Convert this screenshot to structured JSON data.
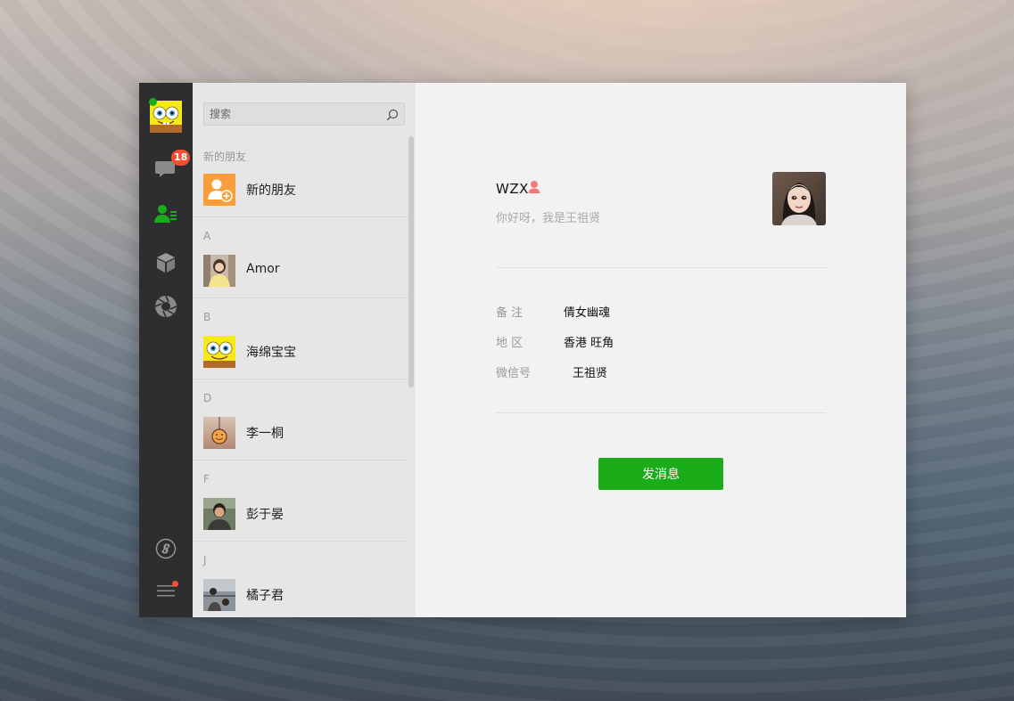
{
  "nav": {
    "unread_count": "18",
    "icons": [
      "chat-icon",
      "contacts-icon",
      "favorites-icon",
      "moments-icon",
      "miniprogram-icon",
      "menu-icon"
    ],
    "accent": "#1aad19"
  },
  "search": {
    "placeholder": "搜索"
  },
  "contacts": {
    "groups": [
      {
        "head": "新的朋友",
        "items": [
          "新的朋友"
        ]
      },
      {
        "head": "A",
        "items": [
          "Amor"
        ]
      },
      {
        "head": "B",
        "items": [
          "海绵宝宝"
        ]
      },
      {
        "head": "D",
        "items": [
          "李一桐"
        ]
      },
      {
        "head": "F",
        "items": [
          "彭于晏"
        ]
      },
      {
        "head": "J",
        "items": [
          "橘子君"
        ]
      }
    ]
  },
  "detail": {
    "name": "WZX",
    "signature": "你好呀，我是王祖贤",
    "fields": [
      {
        "label": "备  注",
        "value": "倩女幽魂"
      },
      {
        "label": "地  区",
        "value": "香港 旺角"
      },
      {
        "label": "微信号",
        "value": "王祖贤"
      }
    ],
    "send_label": "发消息"
  }
}
